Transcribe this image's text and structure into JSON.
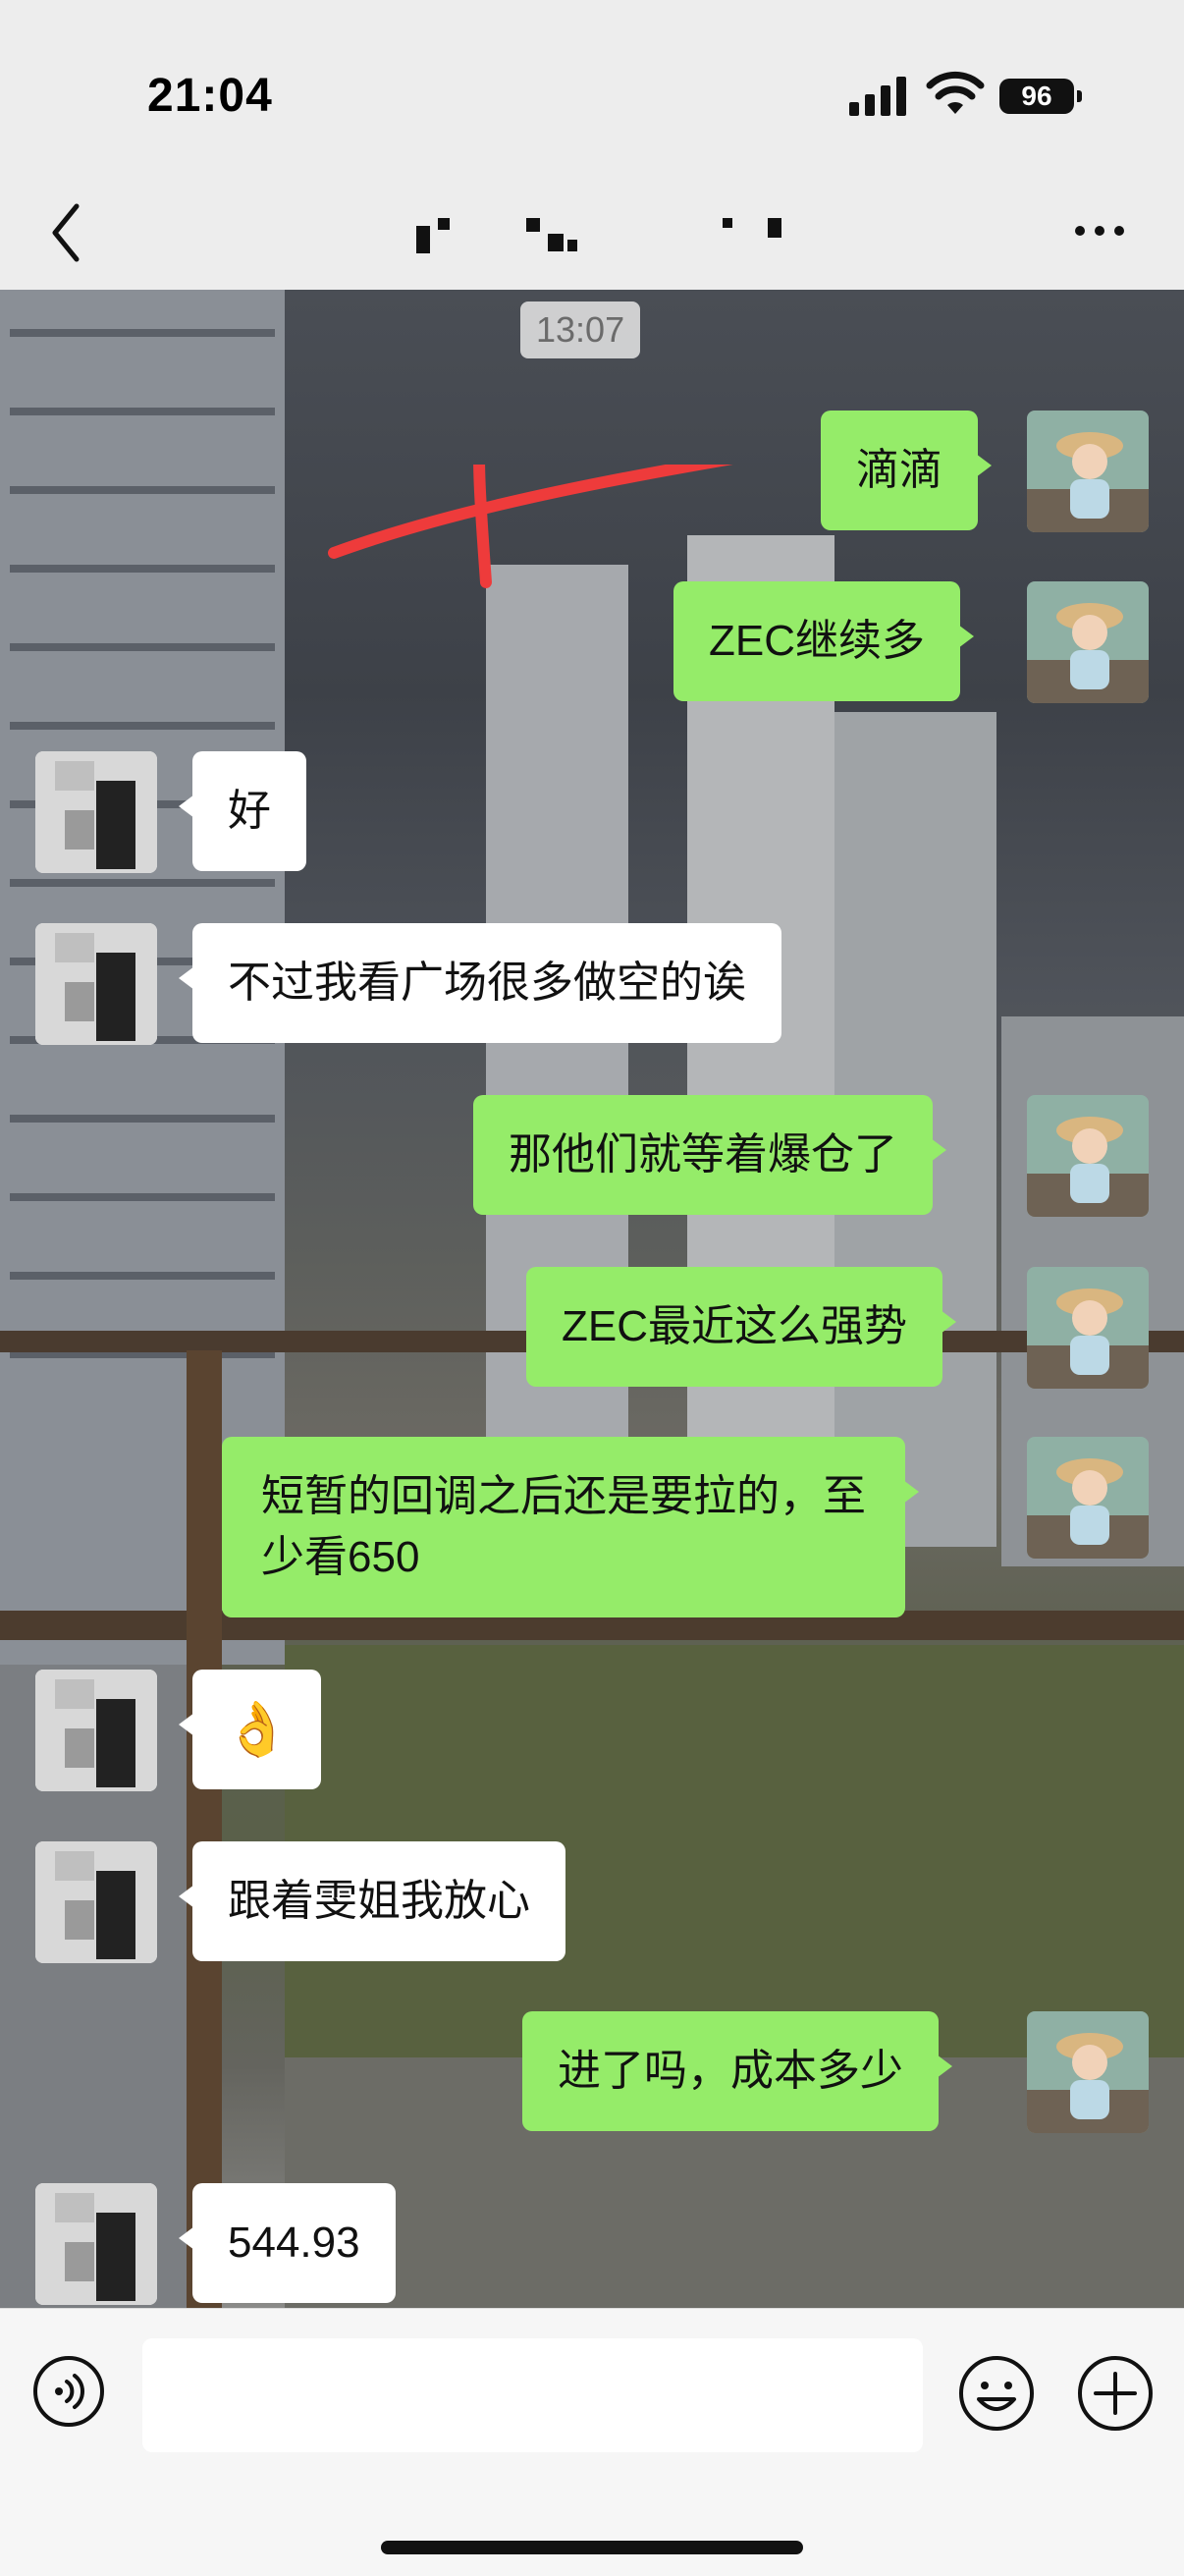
{
  "status_bar": {
    "time": "21:04",
    "battery": "96"
  },
  "nav": {
    "title": ""
  },
  "chat": {
    "timestamp": "13:07",
    "messages": [
      {
        "side": "right",
        "text": "滴滴"
      },
      {
        "side": "right",
        "text": "ZEC继续多"
      },
      {
        "side": "left",
        "text": "好"
      },
      {
        "side": "left",
        "text": "不过我看广场很多做空的诶"
      },
      {
        "side": "right",
        "text": "那他们就等着爆仓了"
      },
      {
        "side": "right",
        "text": "ZEC最近这么强势"
      },
      {
        "side": "right",
        "text_line1": "短暂的回调之后还是要拉的，至",
        "text_line2": "少看650"
      },
      {
        "side": "left",
        "emoji": "👌"
      },
      {
        "side": "left",
        "text": "跟着雯姐我放心"
      },
      {
        "side": "right",
        "text": "进了吗，成本多少"
      },
      {
        "side": "left",
        "text": "544.93"
      }
    ]
  },
  "input_bar": {
    "placeholder": ""
  },
  "colors": {
    "sent_bubble": "#95ec69",
    "received_bubble": "#ffffff",
    "annotation": "#ee3b3b"
  }
}
